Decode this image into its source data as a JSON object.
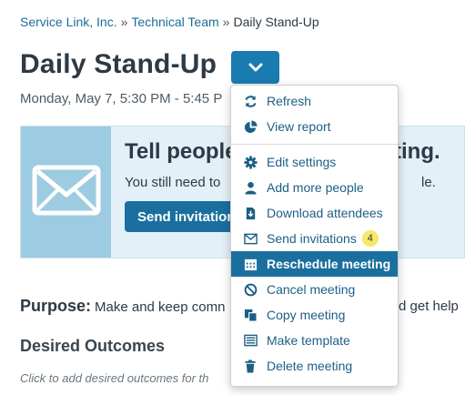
{
  "breadcrumb": {
    "items": [
      "Service Link, Inc.",
      "Technical Team",
      "Daily Stand-Up"
    ],
    "separator": "»"
  },
  "page": {
    "title": "Daily Stand-Up",
    "time": "Monday, May 7, 5:30 PM - 5:45 P"
  },
  "banner": {
    "heading": "Tell people",
    "heading_tail": "ting.",
    "text": "You still need to",
    "text_tail": "le.",
    "button_label": "Send invitation"
  },
  "purpose": {
    "label": "Purpose:",
    "text": "Make and keep comn",
    "text_tail": "d get help"
  },
  "outcomes": {
    "heading": "Desired Outcomes",
    "hint": "Click to add desired outcomes for th"
  },
  "menu": {
    "items": [
      {
        "label": "Refresh",
        "icon": "refresh-icon"
      },
      {
        "label": "View report",
        "icon": "pie-chart-icon"
      },
      {
        "label": "Edit settings",
        "icon": "gear-icon"
      },
      {
        "label": "Add more people",
        "icon": "user-icon"
      },
      {
        "label": "Download attendees",
        "icon": "download-icon"
      },
      {
        "label": "Send invitations",
        "icon": "envelope-icon",
        "badge": "4"
      },
      {
        "label": "Reschedule meeting",
        "icon": "calendar-icon",
        "active": true
      },
      {
        "label": "Cancel meeting",
        "icon": "ban-icon"
      },
      {
        "label": "Copy meeting",
        "icon": "copy-icon"
      },
      {
        "label": "Make template",
        "icon": "template-icon"
      },
      {
        "label": "Delete meeting",
        "icon": "trash-icon"
      }
    ]
  },
  "colors": {
    "accent": "#1a6f9e",
    "link": "#1c6d9a",
    "banner_bg": "#e3f0f7",
    "banner_icon_bg": "#9dcbe2",
    "badge": "#f5e86a"
  }
}
